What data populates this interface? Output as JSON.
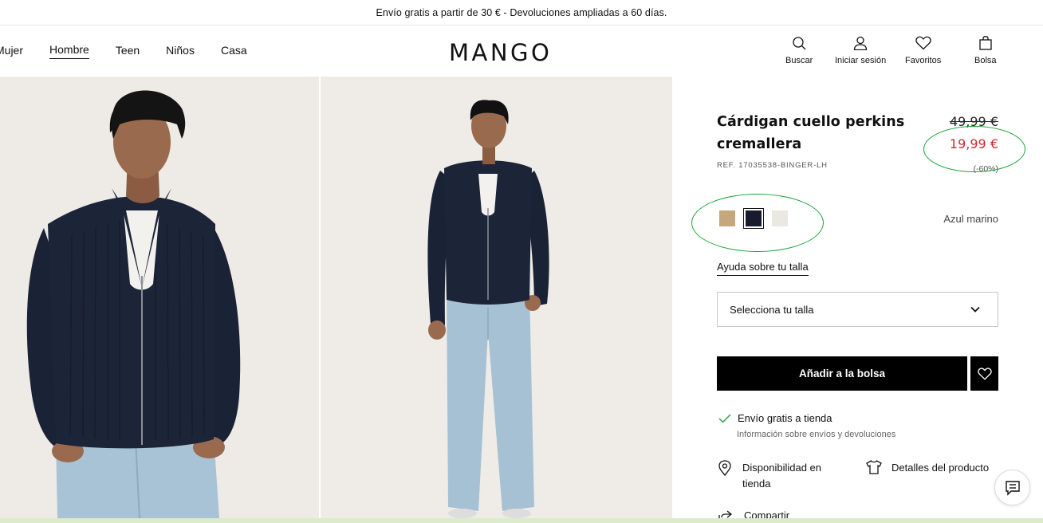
{
  "promo": {
    "text": "Envío gratis a partir de 30 € - Devoluciones ampliadas a 60 días."
  },
  "nav": {
    "items": [
      {
        "label": "Mujer",
        "active": false
      },
      {
        "label": "Hombre",
        "active": true
      },
      {
        "label": "Teen",
        "active": false
      },
      {
        "label": "Niños",
        "active": false
      },
      {
        "label": "Casa",
        "active": false
      }
    ]
  },
  "logo": {
    "text": "MANGO"
  },
  "utilities": {
    "search": "Buscar",
    "login": "Iniciar sesión",
    "favorites": "Favoritos",
    "bag": "Bolsa"
  },
  "product": {
    "title": "Cárdigan cuello perkins cremallera",
    "ref": "REF. 17035538-BINGER-LH",
    "price_old": "49,99 €",
    "price_new": "19,99 €",
    "discount": "(-60%)",
    "colors": [
      {
        "name": "camel",
        "hex": "#c4a77d",
        "selected": false
      },
      {
        "name": "navy",
        "hex": "#161c2e",
        "selected": true
      },
      {
        "name": "cream",
        "hex": "#ebe7e1",
        "selected": false
      }
    ],
    "color_name": "Azul marino",
    "size_help": "Ayuda sobre tu talla",
    "size_placeholder": "Selecciona tu talla",
    "add_to_bag": "Añadir a la bolsa",
    "shipping": "Envío gratis a tienda",
    "shipping_info": "Información sobre envíos y devoluciones",
    "stock": "Disponibilidad en tienda",
    "details": "Detalles del producto",
    "share": "Compartir"
  },
  "colors": {
    "price_sale": "#d3262d",
    "annotation": "#1aa336",
    "check": "#2e9e44"
  }
}
